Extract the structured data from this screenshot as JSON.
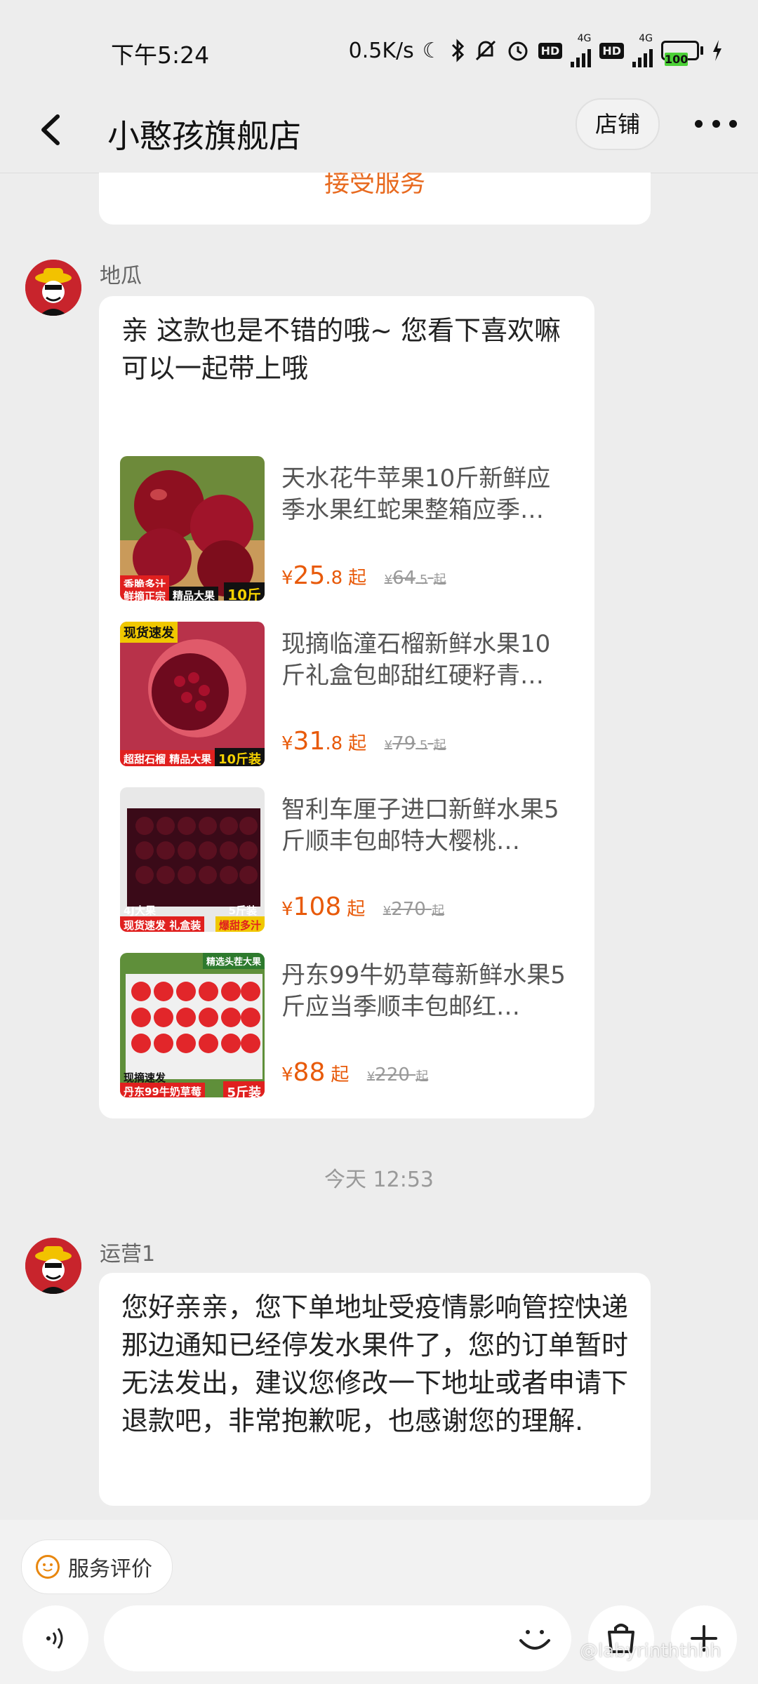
{
  "status_bar": {
    "time": "下午5:24",
    "net_speed": "0.5K/s",
    "sim1_label": "4G",
    "sim2_label": "4G",
    "hd_label": "HD",
    "battery": "100"
  },
  "header": {
    "title": "小憨孩旗舰店",
    "store_button": "店铺"
  },
  "previous_card": {
    "action_text": "接受服务"
  },
  "message1": {
    "sender": "地瓜",
    "text": "亲 这款也是不错的哦~ 您看下喜欢嘛 可以一起带上哦",
    "products": [
      {
        "name": "天水花牛苹果10斤新鲜应季水果红蛇果整箱应季…",
        "currency": "¥",
        "price_int": "25",
        "price_dec": ".8",
        "qi": "起",
        "orig_int": "64",
        "orig_dec": ".5",
        "orig_qi": "起",
        "badges": [
          "香脆多汁",
          "鲜摘正宗",
          "精品大果",
          "10斤"
        ]
      },
      {
        "name": "现摘临潼石榴新鲜水果10斤礼盒包邮甜红硬籽青…",
        "currency": "¥",
        "price_int": "31",
        "price_dec": ".8",
        "qi": "起",
        "orig_int": "79",
        "orig_dec": ".5",
        "orig_qi": "起",
        "badges": [
          "现货速发",
          "超甜石榴 精品大果",
          "10斤装"
        ]
      },
      {
        "name": "智利车厘子进口新鲜水果5斤顺丰包邮特大樱桃…",
        "currency": "¥",
        "price_int": "108",
        "price_dec": "",
        "qi": "起",
        "orig_int": "270",
        "orig_dec": "",
        "orig_qi": "起",
        "badges": [
          "4J大果",
          "5斤装",
          "现货速发 礼盒装",
          "爆甜多汁"
        ]
      },
      {
        "name": "丹东99牛奶草莓新鲜水果5斤应当季顺丰包邮红…",
        "currency": "¥",
        "price_int": "88",
        "price_dec": "",
        "qi": "起",
        "orig_int": "220",
        "orig_dec": "",
        "orig_qi": "起",
        "badges": [
          "精选头茬大果",
          "现摘速发",
          "丹东99牛奶草莓",
          "5斤装"
        ]
      }
    ]
  },
  "timestamp": "今天  12:53",
  "message2": {
    "sender": "运营1",
    "text": "您好亲亲，您下单地址受疫情影响管控快递那边通知已经停发水果件了，您的订单暂时无法发出，建议您修改一下地址或者申请下退款吧，非常抱歉呢，也感谢您的理解."
  },
  "bottom": {
    "rating_label": "服务评价",
    "input_placeholder": ""
  },
  "watermark": "@labyrinththhh",
  "colors": {
    "accent": "#e85a0a",
    "background": "#ededed",
    "avatar_bg": "#c8242c"
  }
}
